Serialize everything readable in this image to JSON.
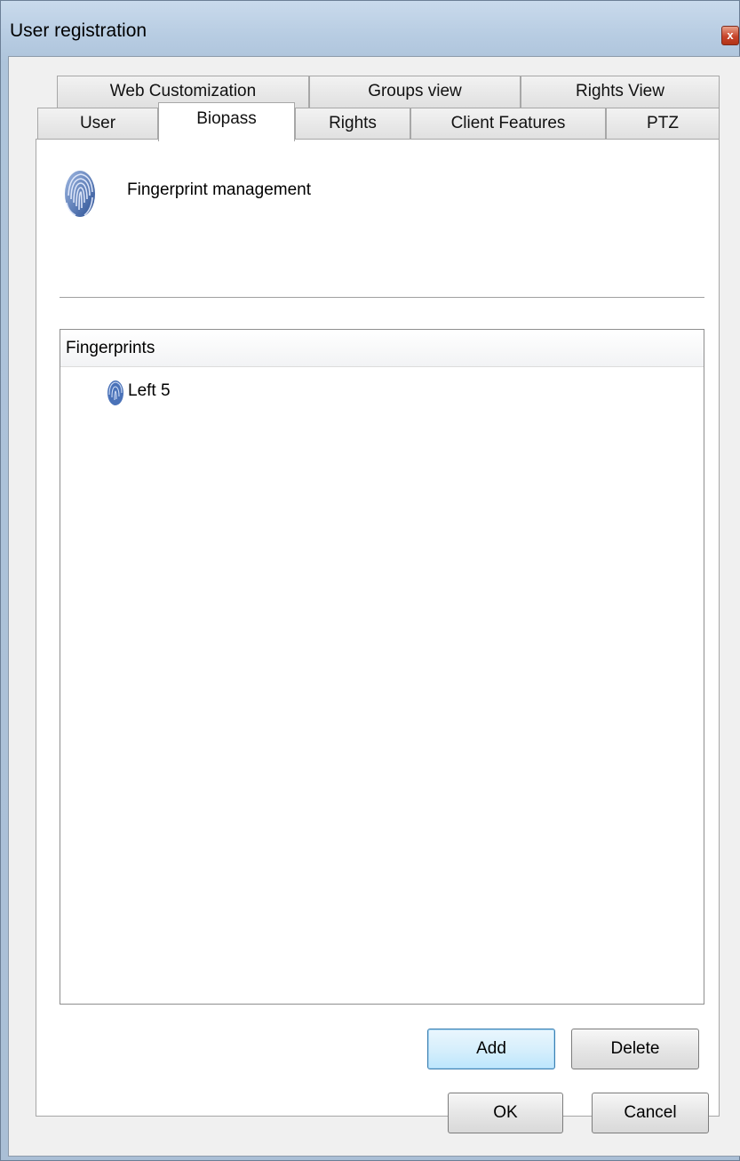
{
  "window": {
    "title": "User registration",
    "close_glyph": "x"
  },
  "tabs": {
    "row_back": [
      {
        "label": "Web Customization"
      },
      {
        "label": "Groups view"
      },
      {
        "label": "Rights View"
      }
    ],
    "row_front": [
      {
        "label": "User"
      },
      {
        "label": "Biopass",
        "active": true
      },
      {
        "label": "Rights"
      },
      {
        "label": "Client Features"
      },
      {
        "label": "PTZ"
      }
    ]
  },
  "panel": {
    "header_icon": "fingerprint-icon",
    "header_text": "Fingerprint management",
    "list": {
      "column_header": "Fingerprints",
      "items": [
        {
          "icon": "fingerprint-small-icon",
          "label": "Left 5"
        }
      ]
    },
    "add_label": "Add",
    "delete_label": "Delete"
  },
  "footer": {
    "ok_label": "OK",
    "cancel_label": "Cancel"
  },
  "colors": {
    "fingerprint": "#3a62a8",
    "default_button_border": "#3c7fb1"
  }
}
